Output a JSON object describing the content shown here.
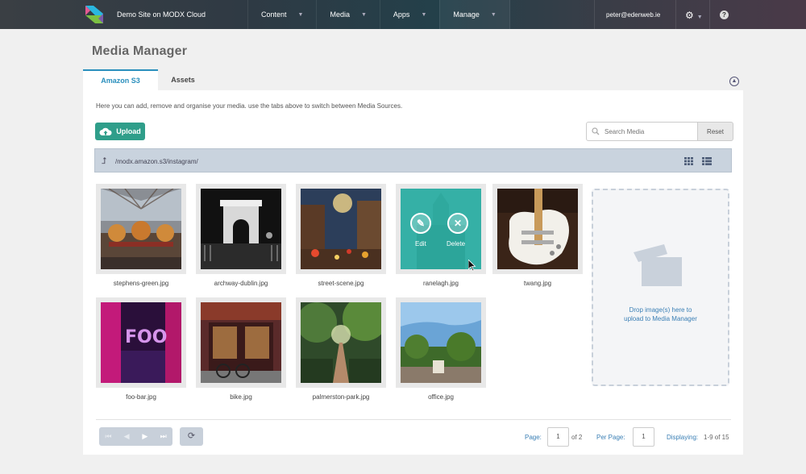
{
  "header": {
    "site_name": "Demo Site on MODX Cloud",
    "nav": [
      {
        "label": "Content"
      },
      {
        "label": "Media"
      },
      {
        "label": "Apps"
      },
      {
        "label": "Manage"
      }
    ],
    "user_email": "peter@edenweb.ie",
    "help_label": "?"
  },
  "page": {
    "title": "Media Manager",
    "tabs": [
      {
        "label": "Amazon S3",
        "active": true
      },
      {
        "label": "Assets",
        "active": false
      }
    ],
    "intro": "Here you can add, remove and organise your media. use the tabs above to switch between Media Sources."
  },
  "toolbar": {
    "upload_label": "Upload",
    "search_placeholder": "Search Media",
    "reset_label": "Reset"
  },
  "path": "/modx.amazon.s3/instagram/",
  "files": [
    {
      "name": "stephens-green.jpg"
    },
    {
      "name": "archway-dublin.jpg"
    },
    {
      "name": "street-scene.jpg"
    },
    {
      "name": "ranelagh.jpg"
    },
    {
      "name": "twang.jpg"
    },
    {
      "name": "foo-bar.jpg"
    },
    {
      "name": "bike.jpg"
    },
    {
      "name": "palmerston-park.jpg"
    },
    {
      "name": "office.jpg"
    }
  ],
  "hover_actions": {
    "edit": "Edit",
    "delete": "Delete"
  },
  "dropzone": {
    "line1": "Drop image(s) here to",
    "line2": "upload to Media Manager"
  },
  "pagination": {
    "page_label": "Page:",
    "page_value": "1",
    "of_label": "of 2",
    "per_page_label": "Per Page:",
    "per_page_value": "1",
    "displaying_label": "Displaying:",
    "displaying_value": "1-9 of 15"
  },
  "colors": {
    "accent": "#2a8fbd",
    "upload": "#2f9e8a",
    "overlay": "#1eb4a0"
  }
}
